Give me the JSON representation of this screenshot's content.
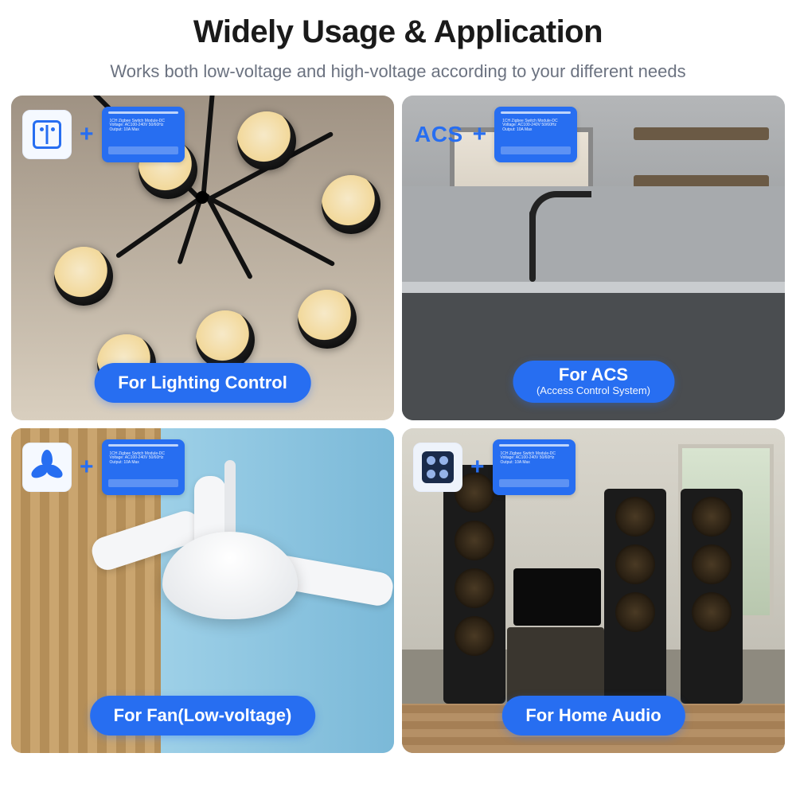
{
  "header": {
    "title": "Widely Usage & Application",
    "subtitle": "Works both low-voltage and high-voltage according to your different needs"
  },
  "module": {
    "label": "1CH Zigbee Switch Module-DC\nVoltage: AC100-240V 50/60Hz\nOutput: 10A Max"
  },
  "plus": "+",
  "cards": [
    {
      "icon": "switch-icon",
      "icon_text": "",
      "pill": "For Lighting Control",
      "pill_sub": ""
    },
    {
      "icon": "acs-text",
      "icon_text": "ACS",
      "pill": "For ACS",
      "pill_sub": "(Access Control System)"
    },
    {
      "icon": "fan-icon",
      "icon_text": "",
      "pill": "For Fan(Low-voltage)",
      "pill_sub": ""
    },
    {
      "icon": "speaker-icon",
      "icon_text": "",
      "pill": "For Home Audio",
      "pill_sub": ""
    }
  ]
}
